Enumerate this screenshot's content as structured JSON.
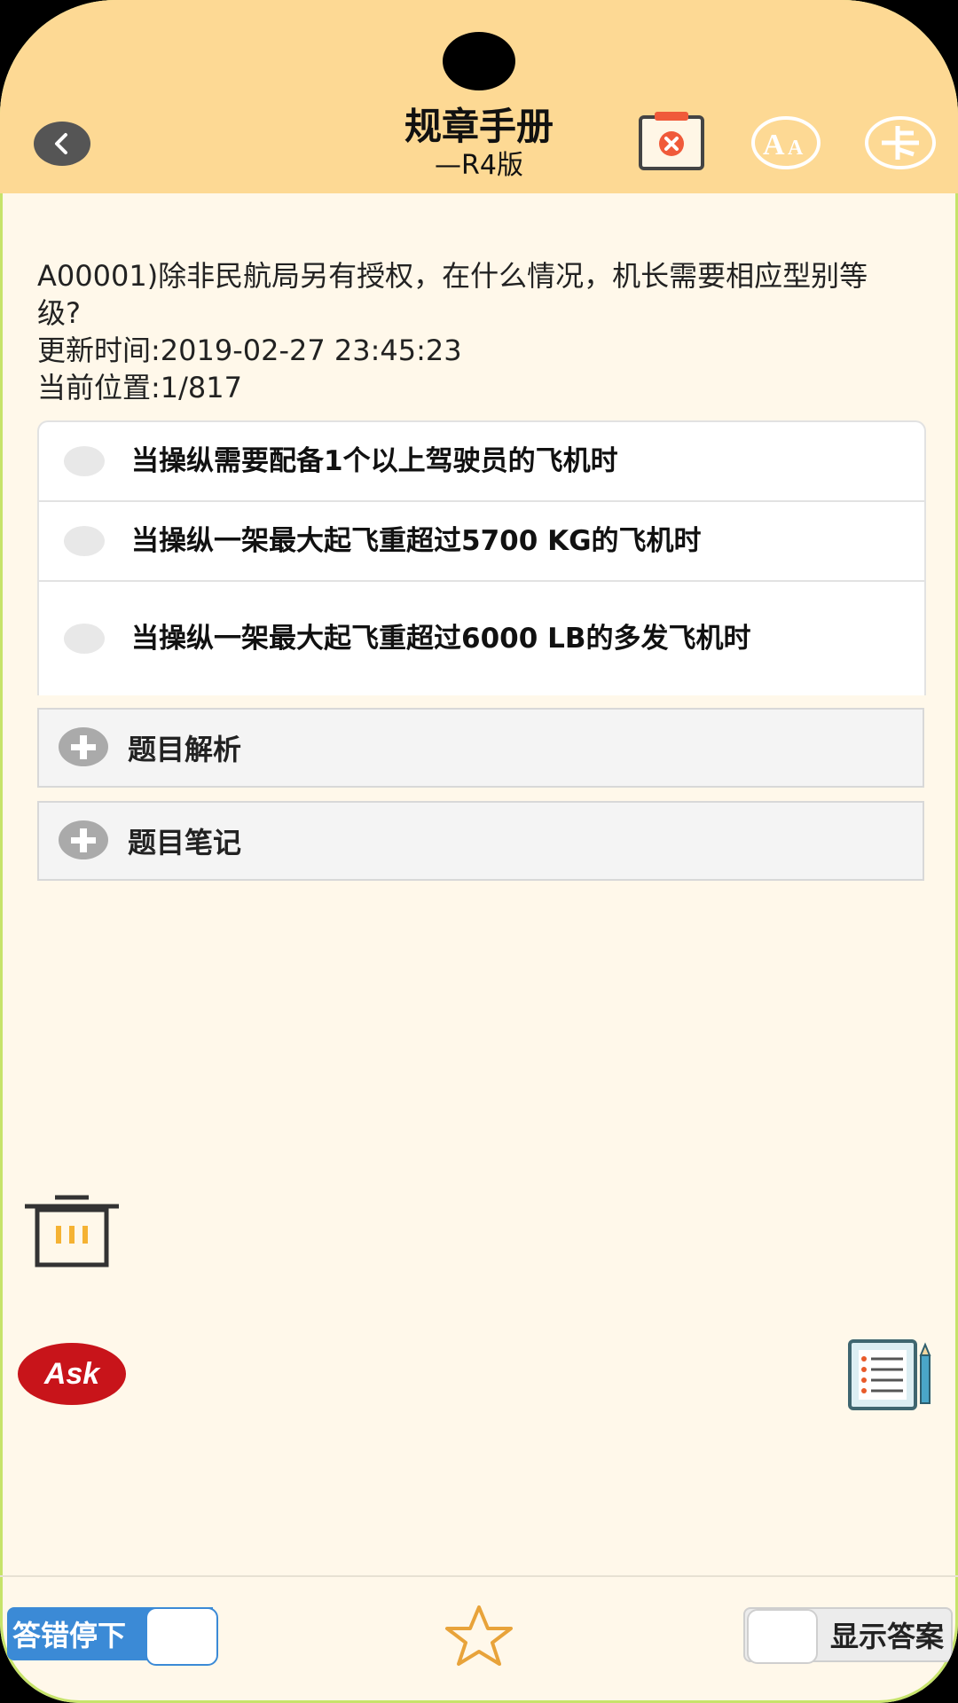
{
  "header": {
    "title": "规章手册",
    "subtitle": "—R4版",
    "icons": [
      "back-arrow-icon",
      "clipboard-close-icon",
      "font-size-icon",
      "card-icon"
    ],
    "colors": {
      "background": "#fdd994",
      "accent": "#f05a3a"
    }
  },
  "question": {
    "text": "A00001)除非民航局另有授权，在什么情况，机长需要相应型别等级?",
    "updated": "更新时间:2019-02-27 23:45:23",
    "position": "当前位置:1/817"
  },
  "options": [
    {
      "label": "当操纵需要配备1个以上驾驶员的飞机时"
    },
    {
      "label": "当操纵一架最大起飞重超过5700 KG的飞机时"
    },
    {
      "label": "当操纵一架最大起飞重超过6000 LB的多发飞机时"
    }
  ],
  "panels": {
    "analysis": "题目解析",
    "notes": "题目笔记"
  },
  "floating": {
    "ask_label": "Ask",
    "icons": [
      "trash-icon",
      "ask-icon",
      "notes-icon"
    ]
  },
  "bottom": {
    "stop_on_wrong": "答错停下",
    "show_answer": "显示答案",
    "favorite_icon": "star-icon",
    "toggle_color": "#3b8ad6"
  }
}
